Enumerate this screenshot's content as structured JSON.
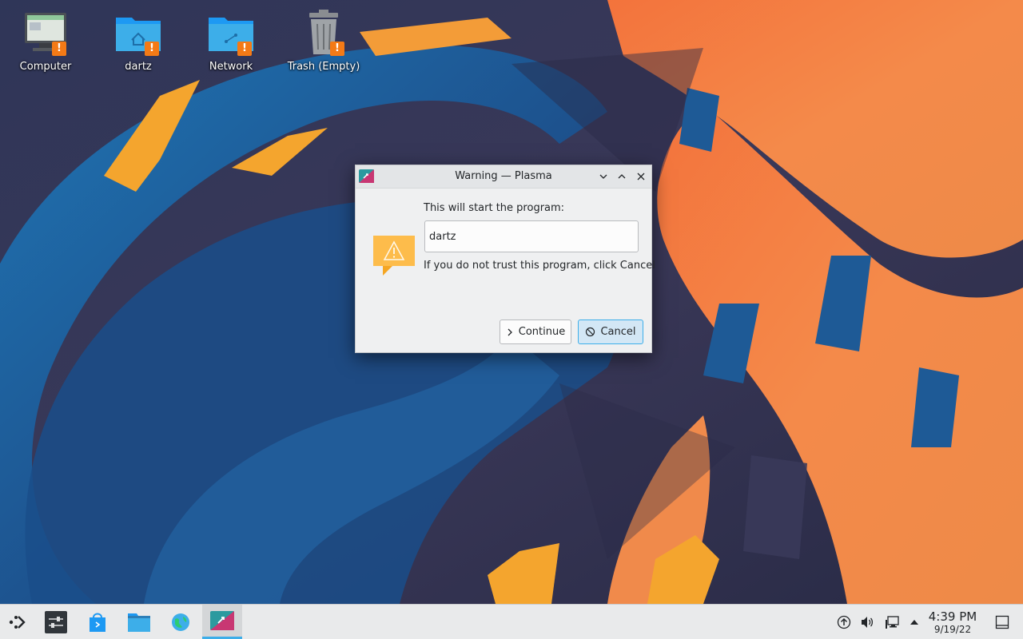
{
  "desktop": {
    "icons": [
      {
        "label": "Computer",
        "icon": "computer-icon"
      },
      {
        "label": "dartz",
        "icon": "home-folder-icon"
      },
      {
        "label": "Network",
        "icon": "network-folder-icon"
      },
      {
        "label": "Trash (Empty)",
        "icon": "trash-icon"
      }
    ],
    "badge_glyph": "!"
  },
  "dialog": {
    "title": "Warning — Plasma",
    "prompt": "This will start the program:",
    "program": "dartz",
    "hint": "If you do not trust this program, click Cancel",
    "continue_label": "Continue",
    "cancel_label": "Cancel"
  },
  "taskbar": {
    "launchers": [
      "application-launcher-icon",
      "system-settings-icon",
      "discover-icon",
      "dolphin-icon",
      "web-browser-icon"
    ],
    "tray": [
      "updates-icon",
      "volume-icon",
      "network-icon",
      "expand-tray-icon"
    ],
    "clock": {
      "time": "4:39 PM",
      "date": "9/19/22"
    }
  },
  "colors": {
    "accent": "#3daee9",
    "badge": "#f47a16",
    "folder": "#3daee9",
    "warning": "#fdbc4b"
  }
}
